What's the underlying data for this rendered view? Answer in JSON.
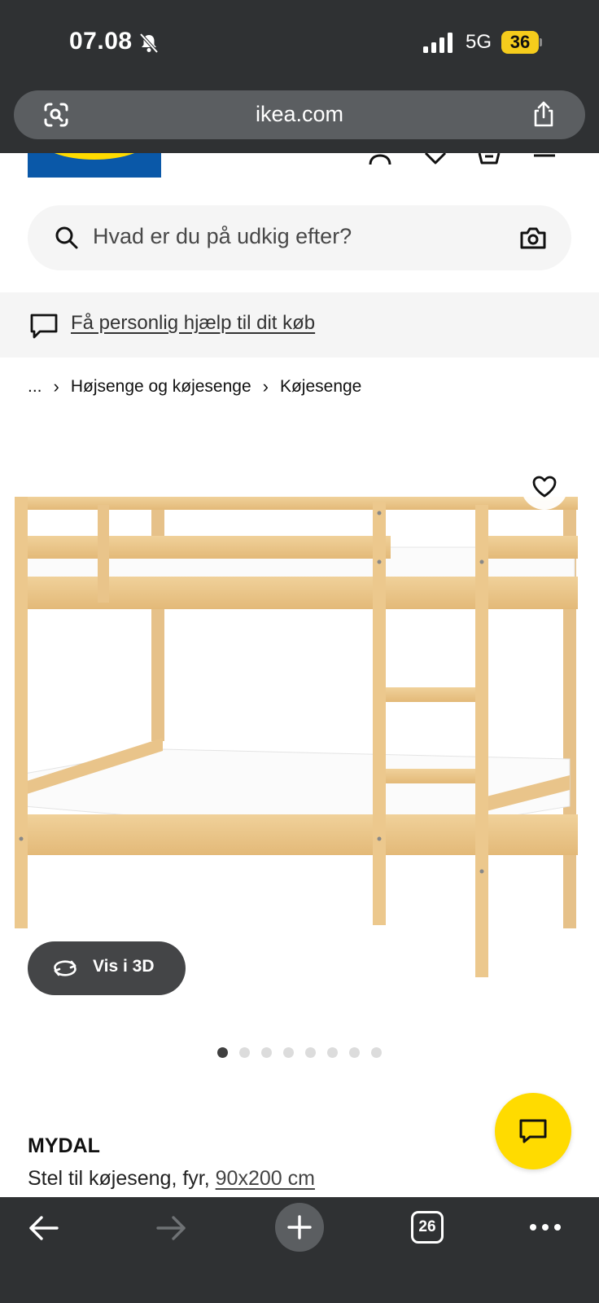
{
  "status_bar": {
    "time": "07.08",
    "network": "5G",
    "battery": "36"
  },
  "browser": {
    "url": "ikea.com",
    "open_tabs": "26"
  },
  "search": {
    "placeholder": "Hvad er du på udkig efter?"
  },
  "help": {
    "link_text": "Få personlig hjælp til dit køb"
  },
  "breadcrumb": {
    "ellipsis": "...",
    "items": [
      "Højsenge og køjesenge",
      "Køjesenge"
    ],
    "separator": "›"
  },
  "product": {
    "view_3d_label": "Vis i 3D",
    "image_count": 8,
    "active_image": 1,
    "name": "MYDAL",
    "description": "Stel til køjeseng, fyr,",
    "size": "90x200 cm"
  },
  "colors": {
    "ikea_blue": "#0058A3",
    "ikea_yellow": "#FFDB00",
    "chrome_dark": "#2F3133"
  }
}
